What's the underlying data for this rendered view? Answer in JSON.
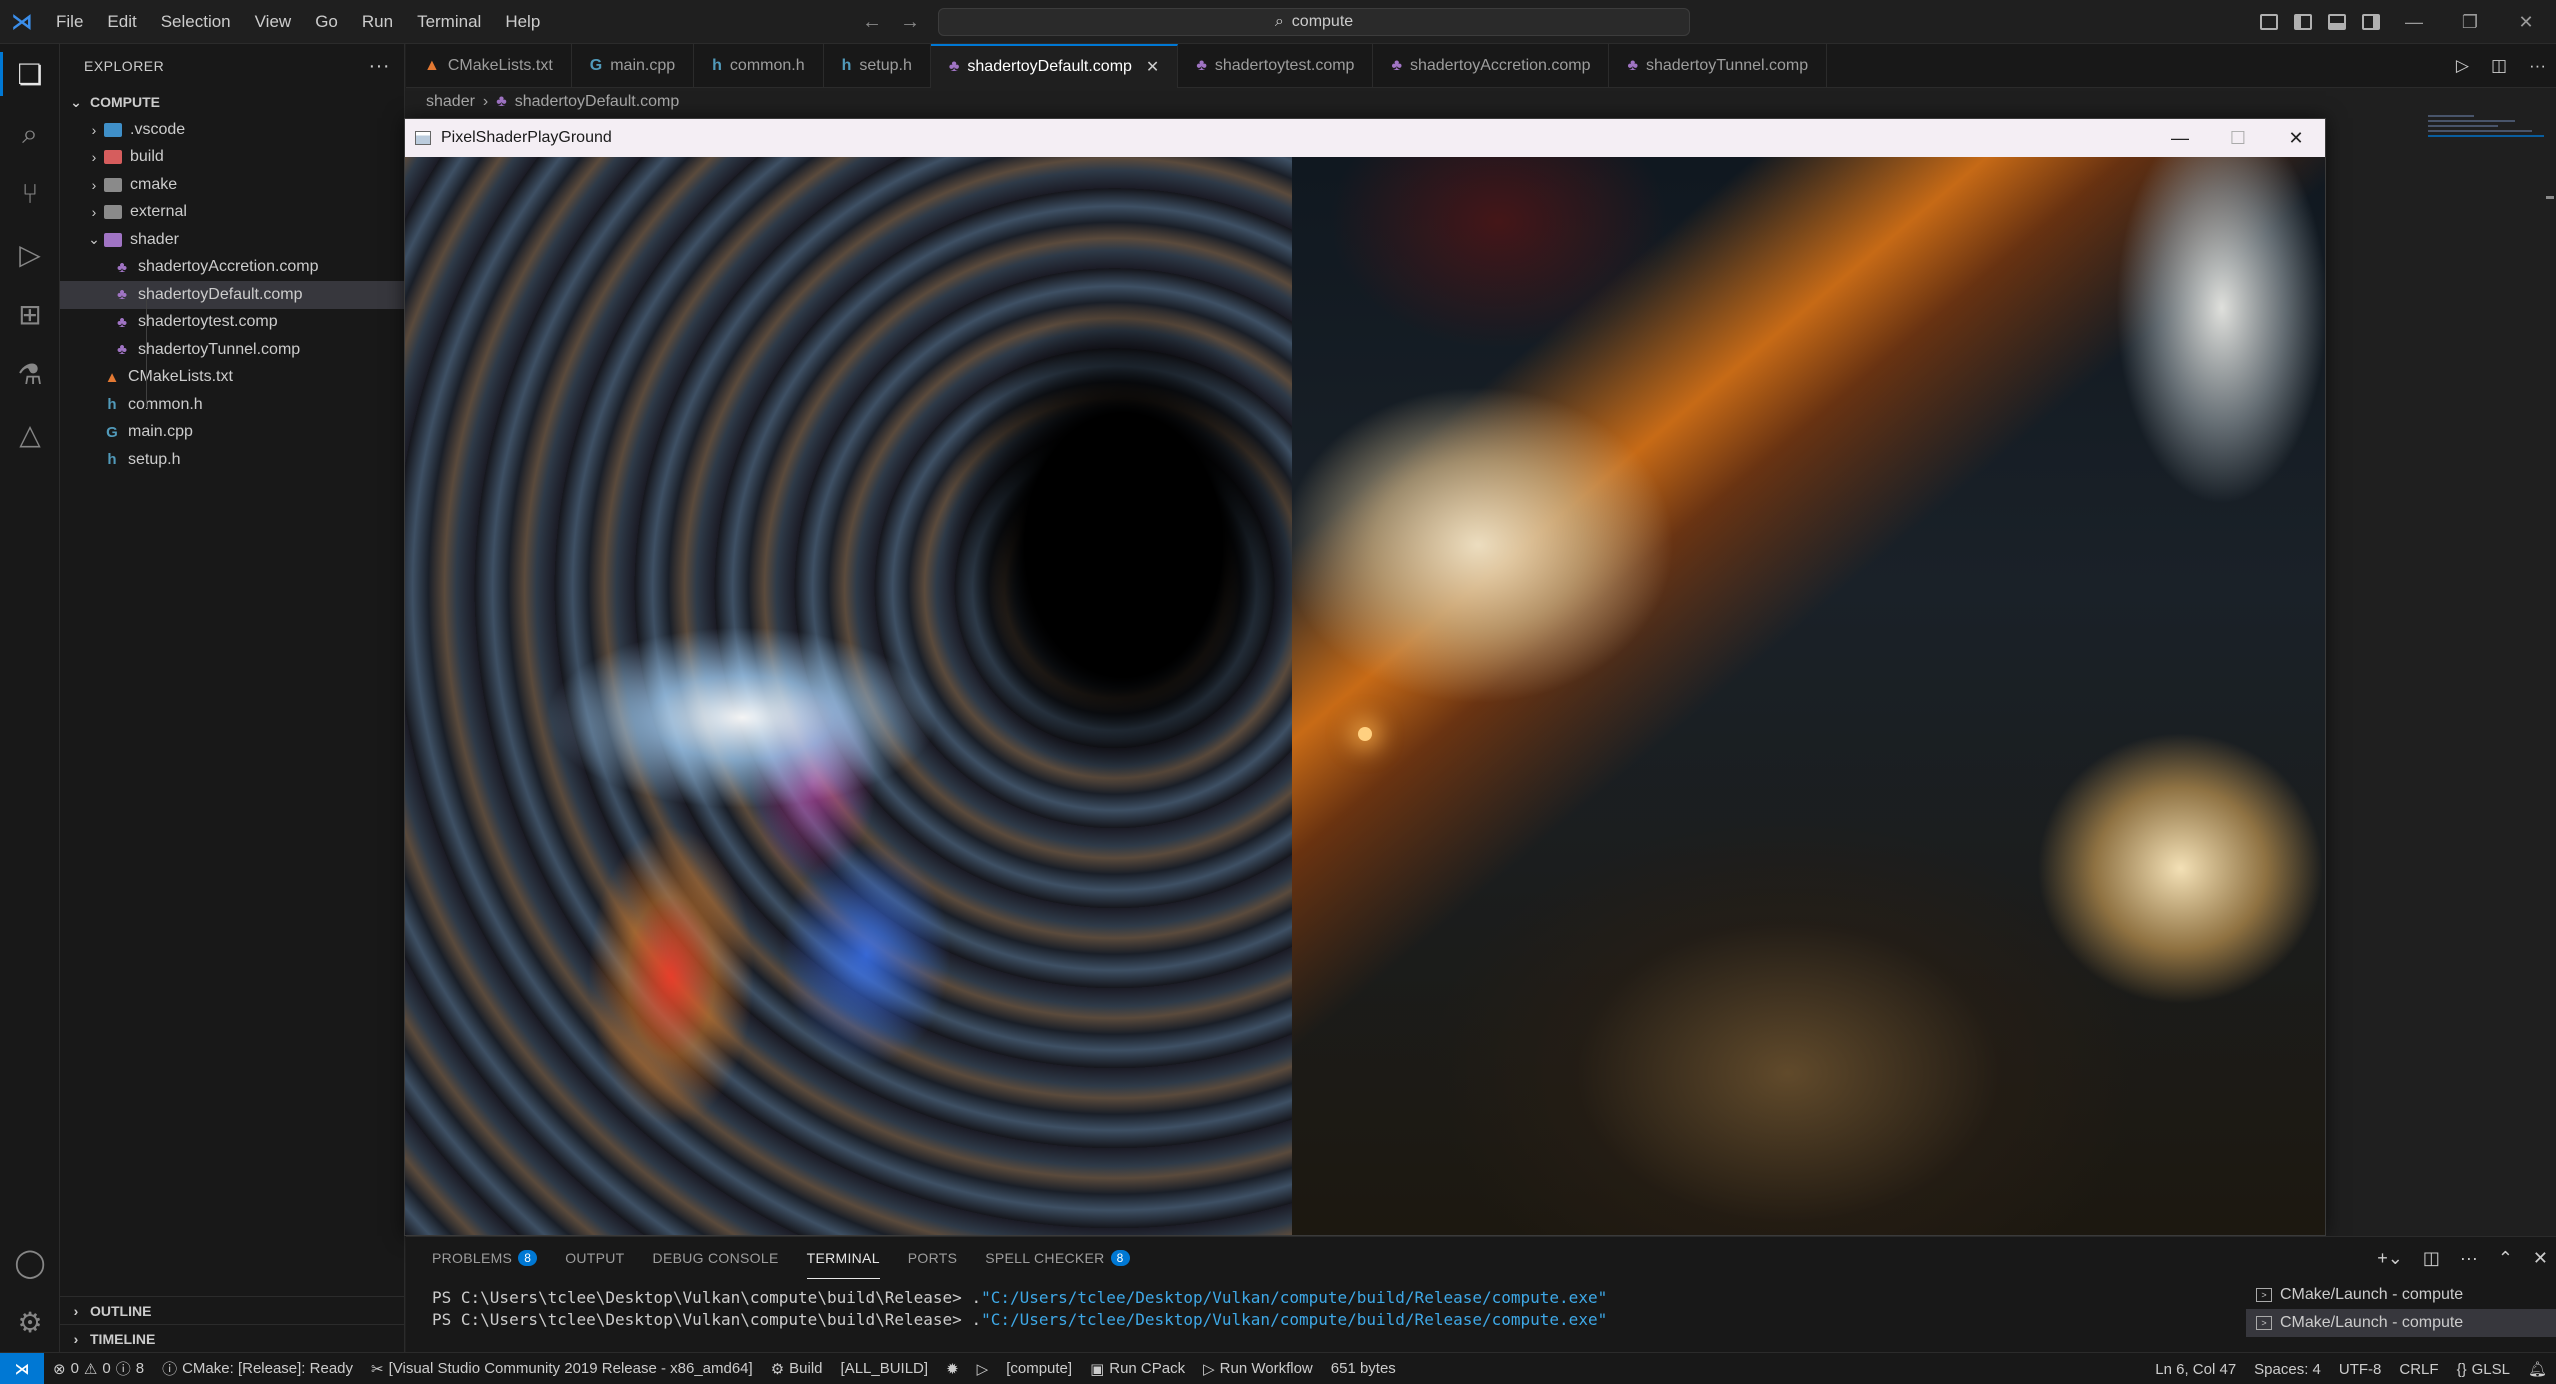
{
  "titlebar": {
    "menu": [
      "File",
      "Edit",
      "Selection",
      "View",
      "Go",
      "Run",
      "Terminal",
      "Help"
    ],
    "search_text": "compute"
  },
  "explorer": {
    "header": "EXPLORER",
    "root": "COMPUTE",
    "folders": [
      ".vscode",
      "build",
      "cmake",
      "external",
      "shader"
    ],
    "shader_files": [
      "shadertoyAccretion.comp",
      "shadertoyDefault.comp",
      "shadertoytest.comp",
      "shadertoyTunnel.comp"
    ],
    "root_files": [
      "CMakeLists.txt",
      "common.h",
      "main.cpp",
      "setup.h"
    ],
    "outline": "OUTLINE",
    "timeline": "TIMELINE"
  },
  "tabs": [
    "CMakeLists.txt",
    "main.cpp",
    "common.h",
    "setup.h",
    "shadertoyDefault.comp",
    "shadertoytest.comp",
    "shadertoyAccretion.comp",
    "shadertoyTunnel.comp"
  ],
  "breadcrumb": {
    "folder": "shader",
    "file": "shadertoyDefault.comp"
  },
  "app_window": {
    "title": "PixelShaderPlayGround"
  },
  "panel": {
    "tabs": {
      "problems": "PROBLEMS",
      "problems_count": "8",
      "output": "OUTPUT",
      "debug_console": "DEBUG CONSOLE",
      "terminal": "TERMINAL",
      "ports": "PORTS",
      "spell_checker": "SPELL CHECKER",
      "spell_checker_count": "8"
    },
    "terminal_lines": [
      {
        "prompt": "PS C:\\Users\\tclee\\Desktop\\Vulkan\\compute\\build\\Release> .",
        "path": "\"C:/Users/tclee/Desktop/Vulkan/compute/build/Release/compute.exe\""
      },
      {
        "prompt": "PS C:\\Users\\tclee\\Desktop\\Vulkan\\compute\\build\\Release> .",
        "path": "\"C:/Users/tclee/Desktop/Vulkan/compute/build/Release/compute.exe\""
      }
    ],
    "terminal_list": [
      "CMake/Launch - compute",
      "CMake/Launch - compute"
    ]
  },
  "statusbar": {
    "errors": "0",
    "warnings": "0",
    "info": "8",
    "cmake_status": "CMake: [Release]: Ready",
    "kit": "[Visual Studio Community 2019 Release - x86_amd64]",
    "build": "Build",
    "build_target": "[ALL_BUILD]",
    "launch_target": "[compute]",
    "run_cpack": "Run CPack",
    "run_workflow": "Run Workflow",
    "file_size": "651 bytes",
    "position": "Ln 6, Col 47",
    "spaces": "Spaces: 4",
    "encoding": "UTF-8",
    "eol": "CRLF",
    "language": "GLSL"
  }
}
